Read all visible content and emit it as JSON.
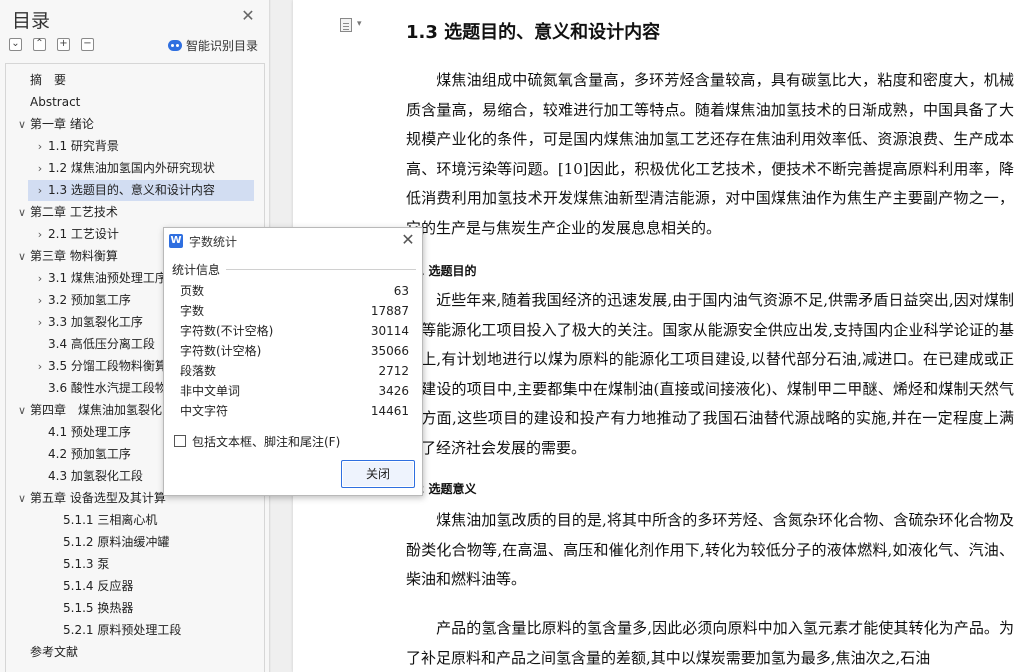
{
  "toc": {
    "title": "目录",
    "smart_label": "智能识别目录",
    "items": [
      {
        "label": "摘　要",
        "level": 0,
        "chev": ""
      },
      {
        "label": "Abstract",
        "level": 0,
        "chev": ""
      },
      {
        "label": "第一章 绪论",
        "level": 0,
        "chev": "∨"
      },
      {
        "label": "1.1 研究背景",
        "level": 1,
        "chev": "›"
      },
      {
        "label": "1.2 煤焦油加氢国内外研究现状",
        "level": 1,
        "chev": "›"
      },
      {
        "label": "1.3 选题目的、意义和设计内容",
        "level": 1,
        "chev": "›",
        "selected": true
      },
      {
        "label": "第二章 工艺技术",
        "level": 0,
        "chev": "∨"
      },
      {
        "label": "2.1 工艺设计",
        "level": 1,
        "chev": "›"
      },
      {
        "label": "第三章 物料衡算",
        "level": 0,
        "chev": "∨"
      },
      {
        "label": "3.1 煤焦油预处理工序",
        "level": 1,
        "chev": "›"
      },
      {
        "label": "3.2 预加氢工序",
        "level": 1,
        "chev": "›"
      },
      {
        "label": "3.3 加氢裂化工序",
        "level": 1,
        "chev": "›"
      },
      {
        "label": "3.4 高低压分离工段",
        "level": 1,
        "chev": ""
      },
      {
        "label": "3.5 分馏工段物料衡算",
        "level": 1,
        "chev": "›"
      },
      {
        "label": "3.6 酸性水汽提工段物",
        "level": 1,
        "chev": ""
      },
      {
        "label": "第四章　煤焦油加氢裂化",
        "level": 0,
        "chev": "∨"
      },
      {
        "label": "4.1 预处理工序",
        "level": 1,
        "chev": ""
      },
      {
        "label": "4.2 预加氢工序",
        "level": 1,
        "chev": ""
      },
      {
        "label": "4.3 加氢裂化工段",
        "level": 1,
        "chev": ""
      },
      {
        "label": "第五章 设备选型及其计算",
        "level": 0,
        "chev": "∨"
      },
      {
        "label": "5.1.1 三相离心机",
        "level": 2,
        "chev": ""
      },
      {
        "label": "5.1.2 原料油缓冲罐",
        "level": 2,
        "chev": ""
      },
      {
        "label": "5.1.3 泵",
        "level": 2,
        "chev": ""
      },
      {
        "label": "5.1.4 反应器",
        "level": 2,
        "chev": ""
      },
      {
        "label": "5.1.5 换热器",
        "level": 2,
        "chev": ""
      },
      {
        "label": "5.2.1 原料预处理工段",
        "level": 2,
        "chev": ""
      },
      {
        "label": "参考文献",
        "level": 0,
        "chev": ""
      }
    ]
  },
  "document": {
    "heading": "1.3  选题目的、意义和设计内容",
    "p1": "煤焦油组成中硫氮氧含量高，多环芳烃含量较高，具有碳氢比大，粘度和密度大，机械质含量高，易缩合，较难进行加工等特点。随着煤焦油加氢技术的日渐成熟，中国具备了大规模产业化的条件，可是国内煤焦油加氢工艺还存在焦油利用效率低、资源浪费、生产成本高、环境污染等问题。[10]因此，积极优化工艺技术，便技术不断完善提高原料利用率，降低消费利用加氢技术开发煤焦油新型清洁能源，对中国煤焦油作为焦生产主要副产物之一，它的生产是与焦炭生产企业的发展息息相关的。",
    "sub1": "1  选题目的",
    "p2": "近些年来,随着我国经济的迅速发展,由于国内油气资源不足,供需矛盾日益突出,因对煤制油等能源化工项目投入了极大的关注。国家从能源安全供应出发,支持国内企业科学论证的基础上,有计划地进行以煤为原料的能源化工项目建设,以替代部分石油,减进口。在已建成或正在建设的项目中,主要都集中在煤制油(直接或间接液化)、煤制甲二甲醚、烯烃和煤制天然气等方面,这些项目的建设和投产有力地推动了我国石油替代源战略的实施,并在一定程度上满足了经济社会发展的需要。",
    "sub2": "2  选题意义",
    "p3": "煤焦油加氢改质的目的是,将其中所含的多环芳烃、含氮杂环化合物、含硫杂环化合物及酚类化合物等,在高温、高压和催化剂作用下,转化为较低分子的液体燃料,如液化气、汽油、柴油和燃料油等。",
    "p4": "产品的氢含量比原料的氢含量多,因此必须向原料中加入氢元素才能使其转化为产品。为了补足原料和产品之间氢含量的差额,其中以煤炭需要加氢为最多,焦油次之,石油"
  },
  "dialog": {
    "title": "字数统计",
    "section": "统计信息",
    "stats": [
      {
        "label": "页数",
        "value": "63"
      },
      {
        "label": "字数",
        "value": "17887"
      },
      {
        "label": "字符数(不计空格)",
        "value": "30114"
      },
      {
        "label": "字符数(计空格)",
        "value": "35066"
      },
      {
        "label": "段落数",
        "value": "2712"
      },
      {
        "label": "非中文单词",
        "value": "3426"
      },
      {
        "label": "中文字符",
        "value": "14461"
      }
    ],
    "checkbox_label": "包括文本框、脚注和尾注(F)",
    "close_label": "关闭"
  },
  "colors": {
    "accent": "#2f6fe0",
    "selection": "#d2ddf2"
  }
}
